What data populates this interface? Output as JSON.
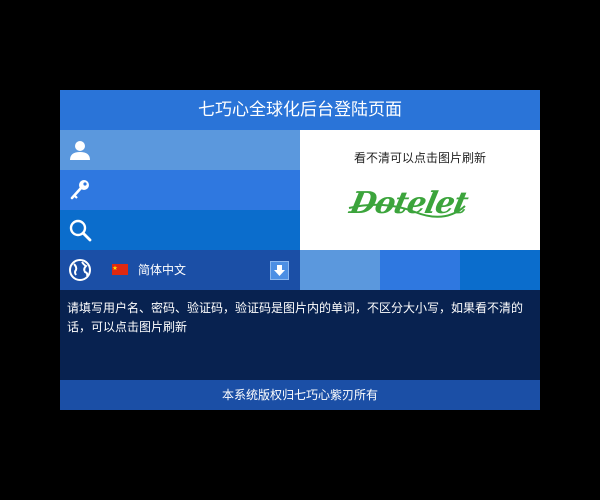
{
  "header": {
    "title": "七巧心全球化后台登陆页面"
  },
  "form": {
    "username": {
      "icon": "user-icon",
      "value": ""
    },
    "password": {
      "icon": "key-icon",
      "value": ""
    },
    "captcha_input": {
      "icon": "search-icon",
      "value": ""
    },
    "language": {
      "icon": "globe-icon",
      "flag": "china-flag-icon",
      "selected": "简体中文",
      "dropdown_icon": "arrow-down-icon"
    }
  },
  "captcha": {
    "tip": "看不清可以点击图片刷新",
    "image_text": "Dotelet",
    "color": "#3ca43c"
  },
  "notice": {
    "text": "请填写用户名、密码、验证码，验证码是图片内的单词，不区分大小写，如果看不清的话，可以点击图片刷新"
  },
  "footer": {
    "text": "本系统版权归七巧心紫刃所有"
  },
  "colors": {
    "header": "#2a74d8",
    "row_light": "#5b98dd",
    "row_mid": "#2f78e0",
    "row_dark": "#0b6dcc",
    "row_deep": "#1b4fa6",
    "notice_bg": "#082250",
    "page_bg": "#000000"
  }
}
